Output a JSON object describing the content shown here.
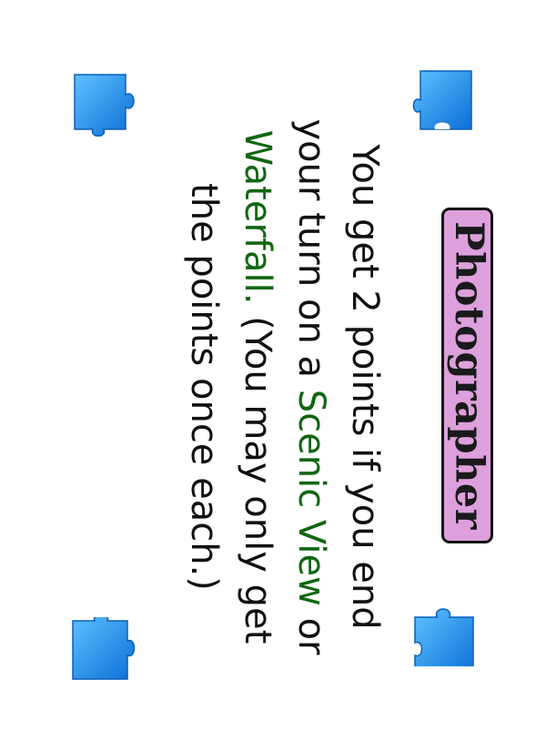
{
  "card": {
    "title": "Photographer",
    "text_before": "You get 2 points if you end your turn on a ",
    "keyword_1": "Scenic View",
    "text_mid": " or ",
    "keyword_2": "Waterfall.",
    "text_after": " (You may only get the points once each.)"
  },
  "colors": {
    "title_background": "#dda0dd",
    "keyword_color": "#116611",
    "piece_color": "#1e90ff"
  },
  "icons": {
    "corner": "puzzle-piece-icon"
  }
}
